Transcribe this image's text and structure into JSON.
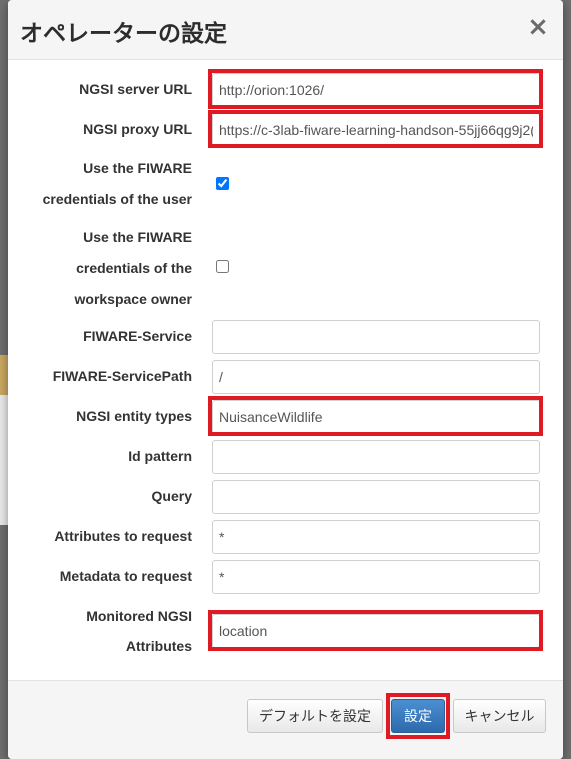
{
  "dialog": {
    "title": "オペレーターの設定",
    "close_label": "×"
  },
  "fields": {
    "ngsi_server_url": {
      "label": "NGSI server URL",
      "value": "http://orion:1026/"
    },
    "ngsi_proxy_url": {
      "label": "NGSI proxy URL",
      "value": "https://c-3lab-fiware-learning-handson-55jj66qg9j2("
    },
    "use_user_credentials": {
      "label_lines": [
        "Use the FIWARE",
        "credentials of the user"
      ],
      "checked": true
    },
    "use_owner_credentials": {
      "label_lines": [
        "Use the FIWARE",
        "credentials of the",
        "workspace owner"
      ],
      "checked": false
    },
    "fiware_service": {
      "label": "FIWARE-Service",
      "value": ""
    },
    "fiware_service_path": {
      "label": "FIWARE-ServicePath",
      "value": "/"
    },
    "ngsi_entity_types": {
      "label": "NGSI entity types",
      "value": "NuisanceWildlife"
    },
    "id_pattern": {
      "label": "Id pattern",
      "value": ""
    },
    "query": {
      "label": "Query",
      "value": ""
    },
    "attributes_to_request": {
      "label": "Attributes to request",
      "value": "*"
    },
    "metadata_to_request": {
      "label": "Metadata to request",
      "value": "*"
    },
    "monitored_attributes": {
      "label_lines": [
        "Monitored NGSI",
        "Attributes"
      ],
      "value": "location"
    }
  },
  "footer": {
    "default_label": "デフォルトを設定",
    "ok_label": "設定",
    "cancel_label": "キャンセル"
  },
  "colors": {
    "highlight": "#e01a22",
    "primary_button": "#2d6aab"
  }
}
